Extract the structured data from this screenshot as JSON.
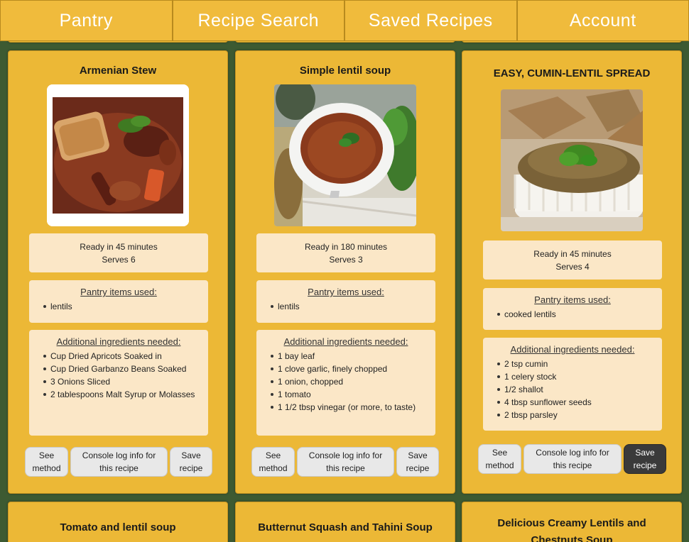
{
  "nav": {
    "items": [
      "Pantry",
      "Recipe Search",
      "Saved Recipes",
      "Account"
    ]
  },
  "labels": {
    "ready_in": "Ready in",
    "minutes": "minutes",
    "serves": "Serves",
    "pantry_heading": "Pantry items used:",
    "additional_heading": "Additional ingredients needed:",
    "see_method": "See method",
    "console_log": "Console log info for this recipe",
    "save_recipe": "Save recipe"
  },
  "recipes": [
    {
      "title": "Armenian Stew",
      "ready_text": "Ready in 45 minutes",
      "serves_text": "Serves 6",
      "pantry_items": [
        "lentils"
      ],
      "additional": [
        "Cup Dried Apricots Soaked in",
        "Cup Dried Garbanzo Beans Soaked",
        "3 Onions Sliced",
        "2 tablespoons Malt Syrup or Molasses"
      ],
      "image_icon": "stew-photo"
    },
    {
      "title": "Simple lentil soup",
      "ready_text": "Ready in 180 minutes",
      "serves_text": "Serves 3",
      "pantry_items": [
        "lentils"
      ],
      "additional": [
        "1 bay leaf",
        "1 clove garlic, finely chopped",
        "1 onion, chopped",
        "1 tomato",
        "1 1/2 tbsp vinegar (or more, to taste)"
      ],
      "image_icon": "soup-bowl-photo"
    },
    {
      "title": "EASY, CUMIN-LENTIL SPREAD",
      "ready_text": "Ready in 45 minutes",
      "serves_text": "Serves 4",
      "pantry_items": [
        "cooked lentils"
      ],
      "additional": [
        "2 tsp cumin",
        "1 celery stock",
        "1/2 shallot",
        "4 tbsp sunflower seeds",
        "2 tbsp parsley"
      ],
      "image_icon": "spread-photo"
    }
  ],
  "next_recipes": [
    {
      "title": "Tomato and lentil soup"
    },
    {
      "title": "Butternut Squash and Tahini Soup"
    },
    {
      "title": "Delicious Creamy Lentils and Chestnuts Soup"
    }
  ],
  "colors": {
    "background": "#3d5a32",
    "card": "#ecb836",
    "nav": "#f0bb3c",
    "box": "#fbe7c7",
    "button": "#e8e8e8",
    "button_active": "#3a3a3a"
  }
}
